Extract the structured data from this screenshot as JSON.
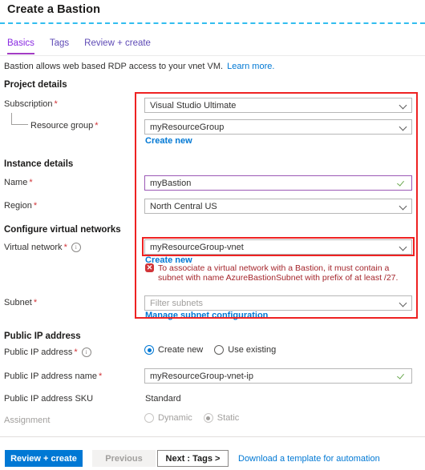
{
  "page": {
    "title": "Create a Bastion",
    "intro_text": "Bastion allows web based RDP access to your vnet VM.",
    "intro_link": "Learn more."
  },
  "tabs": [
    {
      "label": "Basics",
      "active": true
    },
    {
      "label": "Tags",
      "active": false
    },
    {
      "label": "Review + create",
      "active": false
    }
  ],
  "sections": {
    "project_details": {
      "heading": "Project details",
      "subscription": {
        "label": "Subscription",
        "required": "*",
        "value": "Visual Studio Ultimate"
      },
      "resource_group": {
        "label": "Resource group",
        "required": "*",
        "value": "myResourceGroup",
        "create_new_link": "Create new"
      }
    },
    "instance_details": {
      "heading": "Instance details",
      "name": {
        "label": "Name",
        "required": "*",
        "value": "myBastion"
      },
      "region": {
        "label": "Region",
        "required": "*",
        "value": "North Central US"
      }
    },
    "configure_virtual_networks": {
      "heading": "Configure virtual networks",
      "virtual_network": {
        "label": "Virtual network",
        "required": "*",
        "value": "myResourceGroup-vnet",
        "create_new_link": "Create new",
        "error_text": "To associate a virtual network with a Bastion, it must contain a subnet with name AzureBastionSubnet with prefix of at least /27.",
        "error_icon": "error-x-icon"
      },
      "subnet": {
        "label": "Subnet",
        "required": "*",
        "placeholder": "Filter subnets",
        "value": "",
        "manage_link": "Manage subnet configuration"
      }
    },
    "public_ip_address": {
      "heading": "Public IP address",
      "public_ip_address": {
        "label": "Public IP address",
        "required": "*",
        "options": [
          "Create new",
          "Use existing"
        ],
        "selected": "Create new"
      },
      "public_ip_address_name": {
        "label": "Public IP address name",
        "required": "*",
        "value": "myResourceGroup-vnet-ip"
      },
      "public_ip_address_sku": {
        "label": "Public IP address SKU",
        "value": "Standard"
      },
      "assignment": {
        "label": "Assignment",
        "options": [
          "Dynamic",
          "Static"
        ],
        "selected": "Static",
        "disabled": true
      }
    }
  },
  "footer": {
    "review_create": "Review + create",
    "previous": "Previous",
    "next": "Next : Tags >",
    "download_template": "Download a template for automation"
  },
  "colors": {
    "accent_blue": "#0078d4",
    "tab_active": "#a33dc4",
    "error_red": "#d13438",
    "highlight_red": "#ee2222",
    "focus_purple": "#9b59b6",
    "valid_green": "#6aa84f",
    "rule_cyan": "#32bdef"
  }
}
